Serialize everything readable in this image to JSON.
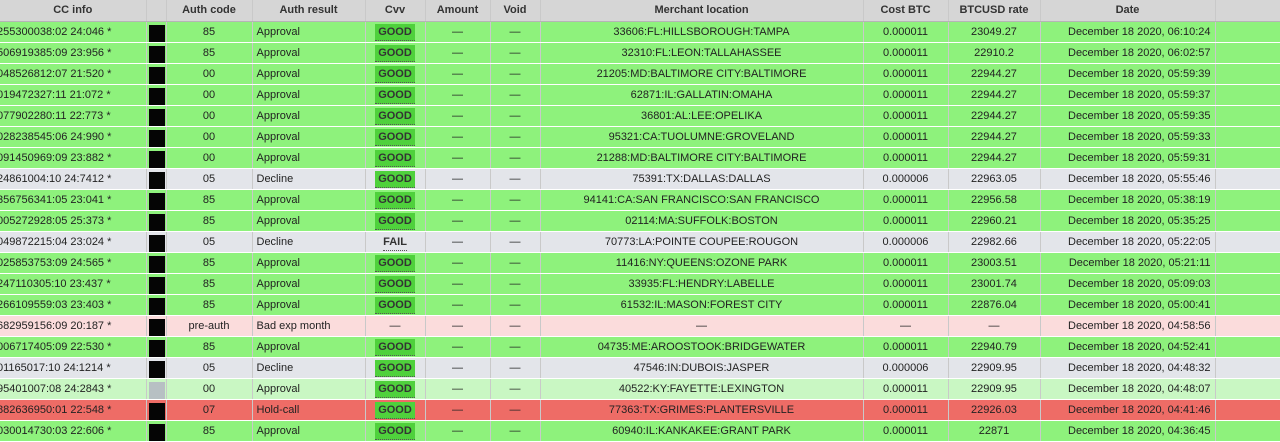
{
  "header": {
    "cc_info": "CC info",
    "auth_code": "Auth code",
    "auth_result": "Auth result",
    "cvv": "Cvv",
    "amount": "Amount",
    "void": "Void",
    "merchant_location": "Merchant location",
    "cost_btc": "Cost BTC",
    "btcusd_rate": "BTCUSD rate",
    "date": "Date"
  },
  "colors": {
    "approval_row": "#8ef27c",
    "decline_row": "#e3e5ea",
    "bad_exp_row": "#fbdcdc",
    "hold_call_row": "#ee6c66",
    "good_badge": "#4fd13c"
  },
  "rows": [
    {
      "cc": "255300038:02 24:046",
      "auth_code": "85",
      "result": "Approval",
      "cvv": "GOOD",
      "amount": "—",
      "void": "—",
      "location": "33606:FL:HILLSBOROUGH:TAMPA",
      "cost": "0.000011",
      "rate": "23049.27",
      "date": "December 18 2020, 06:10:24",
      "status": "approval"
    },
    {
      "cc": "506919385:09 23:956",
      "auth_code": "85",
      "result": "Approval",
      "cvv": "GOOD",
      "amount": "—",
      "void": "—",
      "location": "32310:FL:LEON:TALLAHASSEE",
      "cost": "0.000011",
      "rate": "22910.2",
      "date": "December 18 2020, 06:02:57",
      "status": "approval"
    },
    {
      "cc": "048526812:07 21:520",
      "auth_code": "00",
      "result": "Approval",
      "cvv": "GOOD",
      "amount": "—",
      "void": "—",
      "location": "21205:MD:BALTIMORE CITY:BALTIMORE",
      "cost": "0.000011",
      "rate": "22944.27",
      "date": "December 18 2020, 05:59:39",
      "status": "approval"
    },
    {
      "cc": "019472327:11 21:072",
      "auth_code": "00",
      "result": "Approval",
      "cvv": "GOOD",
      "amount": "—",
      "void": "—",
      "location": "62871:IL:GALLATIN:OMAHA",
      "cost": "0.000011",
      "rate": "22944.27",
      "date": "December 18 2020, 05:59:37",
      "status": "approval"
    },
    {
      "cc": "077902280:11 22:773",
      "auth_code": "00",
      "result": "Approval",
      "cvv": "GOOD",
      "amount": "—",
      "void": "—",
      "location": "36801:AL:LEE:OPELIKA",
      "cost": "0.000011",
      "rate": "22944.27",
      "date": "December 18 2020, 05:59:35",
      "status": "approval"
    },
    {
      "cc": "028238545:06 24:990",
      "auth_code": "00",
      "result": "Approval",
      "cvv": "GOOD",
      "amount": "—",
      "void": "—",
      "location": "95321:CA:TUOLUMNE:GROVELAND",
      "cost": "0.000011",
      "rate": "22944.27",
      "date": "December 18 2020, 05:59:33",
      "status": "approval"
    },
    {
      "cc": "091450969:09 23:882",
      "auth_code": "00",
      "result": "Approval",
      "cvv": "GOOD",
      "amount": "—",
      "void": "—",
      "location": "21288:MD:BALTIMORE CITY:BALTIMORE",
      "cost": "0.000011",
      "rate": "22944.27",
      "date": "December 18 2020, 05:59:31",
      "status": "approval"
    },
    {
      "cc": "24861004:10 24:7412",
      "auth_code": "05",
      "result": "Decline",
      "cvv": "GOOD",
      "amount": "—",
      "void": "—",
      "location": "75391:TX:DALLAS:DALLAS",
      "cost": "0.000006",
      "rate": "22963.05",
      "date": "December 18 2020, 05:55:46",
      "status": "decline"
    },
    {
      "cc": "356756341:05 23:041",
      "auth_code": "85",
      "result": "Approval",
      "cvv": "GOOD",
      "amount": "—",
      "void": "—",
      "location": "94141:CA:SAN FRANCISCO:SAN FRANCISCO",
      "cost": "0.000011",
      "rate": "22956.58",
      "date": "December 18 2020, 05:38:19",
      "status": "approval"
    },
    {
      "cc": "005272928:05 25:373",
      "auth_code": "85",
      "result": "Approval",
      "cvv": "GOOD",
      "amount": "—",
      "void": "—",
      "location": "02114:MA:SUFFOLK:BOSTON",
      "cost": "0.000011",
      "rate": "22960.21",
      "date": "December 18 2020, 05:35:25",
      "status": "approval"
    },
    {
      "cc": "049872215:04 23:024",
      "auth_code": "05",
      "result": "Decline",
      "cvv": "FAIL",
      "amount": "—",
      "void": "—",
      "location": "70773:LA:POINTE COUPEE:ROUGON",
      "cost": "0.000006",
      "rate": "22982.66",
      "date": "December 18 2020, 05:22:05",
      "status": "decline"
    },
    {
      "cc": "025853753:09 24:565",
      "auth_code": "85",
      "result": "Approval",
      "cvv": "GOOD",
      "amount": "—",
      "void": "—",
      "location": "11416:NY:QUEENS:OZONE PARK",
      "cost": "0.000011",
      "rate": "23003.51",
      "date": "December 18 2020, 05:21:11",
      "status": "approval"
    },
    {
      "cc": "247110305:10 23:437",
      "auth_code": "85",
      "result": "Approval",
      "cvv": "GOOD",
      "amount": "—",
      "void": "—",
      "location": "33935:FL:HENDRY:LABELLE",
      "cost": "0.000011",
      "rate": "23001.74",
      "date": "December 18 2020, 05:09:03",
      "status": "approval"
    },
    {
      "cc": "266109559:03 23:403",
      "auth_code": "85",
      "result": "Approval",
      "cvv": "GOOD",
      "amount": "—",
      "void": "—",
      "location": "61532:IL:MASON:FOREST CITY",
      "cost": "0.000011",
      "rate": "22876.04",
      "date": "December 18 2020, 05:00:41",
      "status": "approval"
    },
    {
      "cc": "682959156:09 20:187",
      "auth_code": "pre-auth",
      "result": "Bad exp month",
      "cvv": "—",
      "amount": "—",
      "void": "—",
      "location": "—",
      "cost": "—",
      "rate": "—",
      "date": "December 18 2020, 04:58:56",
      "status": "badexp"
    },
    {
      "cc": "006717405:09 22:530",
      "auth_code": "85",
      "result": "Approval",
      "cvv": "GOOD",
      "amount": "—",
      "void": "—",
      "location": "04735:ME:AROOSTOOK:BRIDGEWATER",
      "cost": "0.000011",
      "rate": "22940.79",
      "date": "December 18 2020, 04:52:41",
      "status": "approval"
    },
    {
      "cc": "01165017:10 24:1214",
      "auth_code": "05",
      "result": "Decline",
      "cvv": "GOOD",
      "amount": "—",
      "void": "—",
      "location": "47546:IN:DUBOIS:JASPER",
      "cost": "0.000006",
      "rate": "22909.95",
      "date": "December 18 2020, 04:48:32",
      "status": "decline"
    },
    {
      "cc": "95401007:08 24:2843",
      "auth_code": "00",
      "result": "Approval",
      "cvv": "GOOD",
      "amount": "—",
      "void": "—",
      "location": "40522:KY:FAYETTE:LEXINGTON",
      "cost": "0.000011",
      "rate": "22909.95",
      "date": "December 18 2020, 04:48:07",
      "status": "faded"
    },
    {
      "cc": "882636950:01 22:548",
      "auth_code": "07",
      "result": "Hold-call",
      "cvv": "GOOD",
      "amount": "—",
      "void": "—",
      "location": "77363:TX:GRIMES:PLANTERSVILLE",
      "cost": "0.000011",
      "rate": "22926.03",
      "date": "December 18 2020, 04:41:46",
      "status": "holdcall"
    },
    {
      "cc": "030014730:03 22:606",
      "auth_code": "85",
      "result": "Approval",
      "cvv": "GOOD",
      "amount": "—",
      "void": "—",
      "location": "60940:IL:KANKAKEE:GRANT PARK",
      "cost": "0.000011",
      "rate": "22871",
      "date": "December 18 2020, 04:36:45",
      "status": "approval"
    }
  ]
}
